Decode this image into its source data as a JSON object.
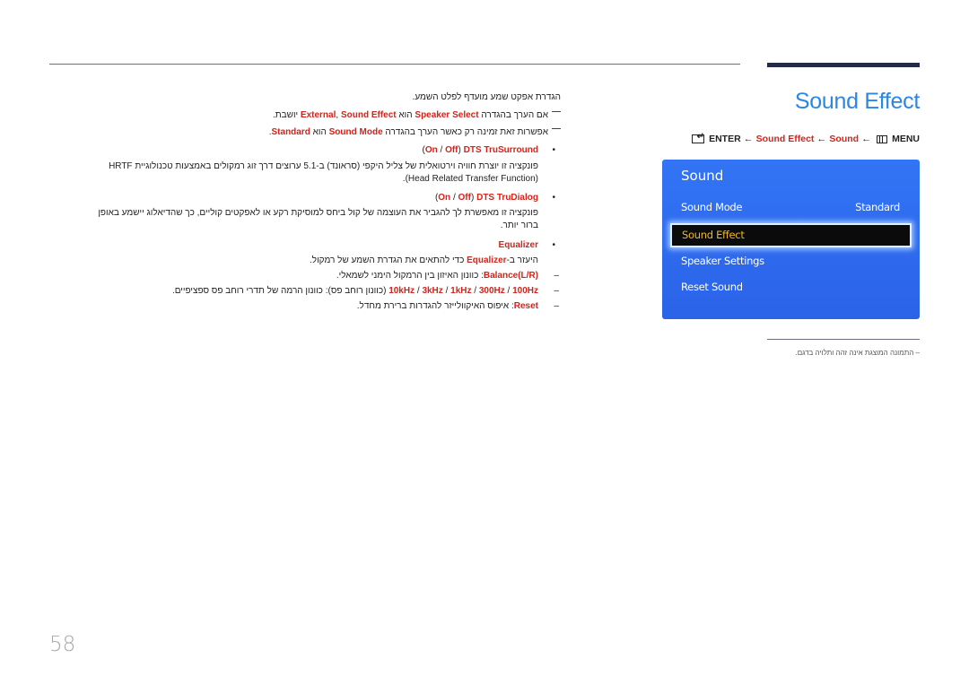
{
  "page": {
    "title": "Sound Effect",
    "number": "58"
  },
  "breadcrumb": {
    "enter": "ENTER",
    "sound_effect": "Sound Effect",
    "sound": "Sound",
    "menu": "MENU",
    "arrow": "←"
  },
  "osd": {
    "title": "Sound",
    "items": [
      {
        "label": "Sound Mode",
        "value": "Standard"
      },
      {
        "label": "Sound Effect",
        "selected": true
      },
      {
        "label": "Speaker Settings"
      },
      {
        "label": "Reset Sound"
      }
    ],
    "colors": {
      "background": "#2f6cf0",
      "selected_bg": "#0a0b0a",
      "selected_text": "#f0b829"
    }
  },
  "note": "– התמונה המוצגת אינה זהה ותלויה בדגם.",
  "body": {
    "intro": "הגדרת אפקט שמע מועדף לפלט השמע.",
    "note1": {
      "a": "אם הערך בהגדרה ",
      "k1": "Speaker Select",
      "b": " הוא ",
      "k2": "External",
      "c": ", ",
      "k3": "Sound Effect",
      "d": " יושבת."
    },
    "note2": {
      "a": "אפשרות זאת זמינה רק כאשר הערך בהגדרה ",
      "k1": "Sound Mode",
      "b": " הוא ",
      "k2": "Standard",
      "c": "."
    },
    "trusurround": {
      "name": "DTS TruSurround",
      "on": "On",
      "off": "Off",
      "desc1": "פונקציה זו יוצרת חוויה וירטואלית של צליל היקפי (סראונד) ב-5.1 ערוצים דרך זוג רמקולים באמצעות טכנולוגיית HRTF",
      "desc2": "(Head Related Transfer Function)."
    },
    "trudialog": {
      "name": "DTS TruDialog",
      "on": "On",
      "off": "Off",
      "desc1": "פונקציה זו מאפשרת לך להגביר את העוצמה של קול ביחס למוסיקת רקע או לאפקטים קוליים, כך שהדיאלוג יישמע באופן",
      "desc2": "ברור יותר."
    },
    "equalizer": {
      "name": "Equalizer",
      "desc_a": "היעזר ב-",
      "desc_k": "Equalizer",
      "desc_b": " כדי להתאים את הגדרת השמע של רמקול.",
      "balance_k": "Balance(L/R)",
      "balance_t": ": כוונון האיזון בין הרמקול הימני לשמאלי.",
      "bands": [
        "100Hz",
        "300Hz",
        "1kHz",
        "3kHz",
        "10kHz"
      ],
      "bands_t": " (כוונון רוחב פס): כוונון הרמה של תדרי רוחב פס ספציפיים.",
      "reset_k": "Reset",
      "reset_t": ": איפוס האיקוולייזר להגדרות ברירת מחדל."
    }
  }
}
